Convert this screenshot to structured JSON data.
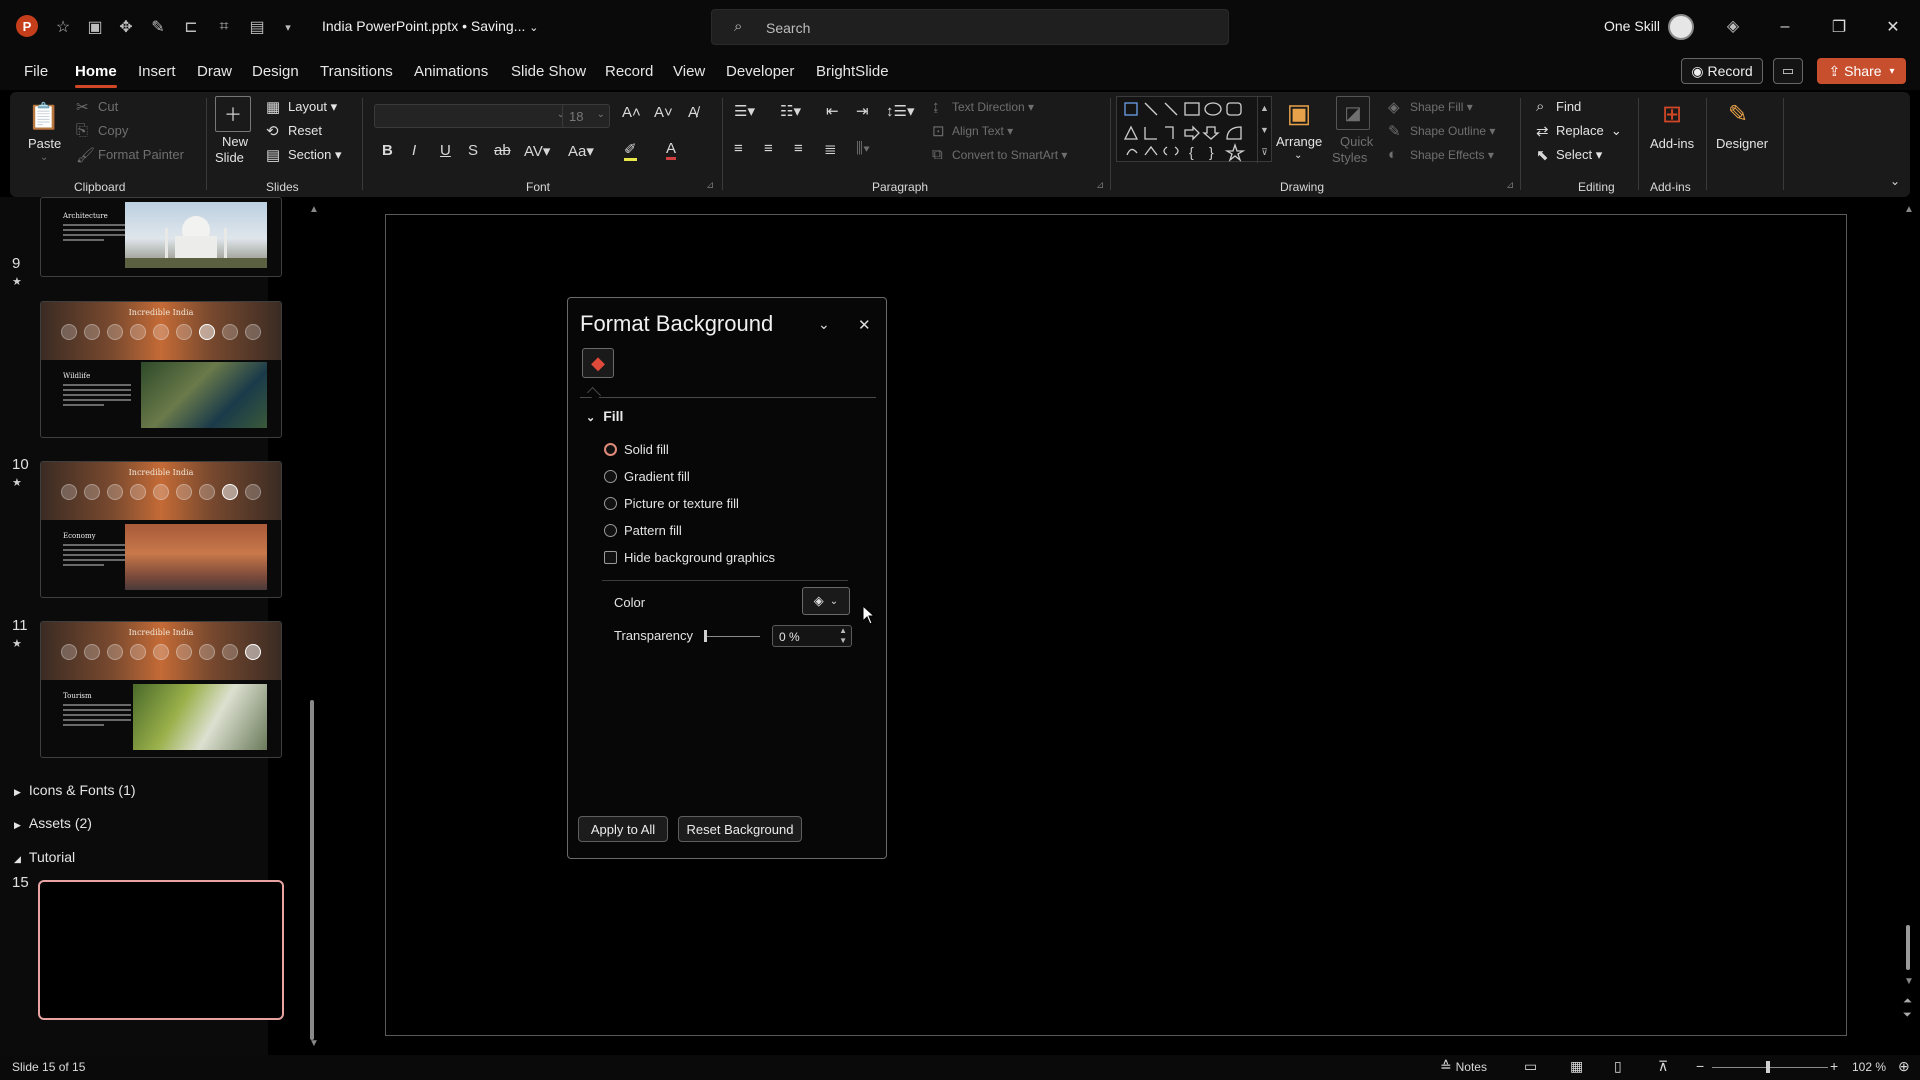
{
  "titlebar": {
    "doc_title": "India PowerPoint.pptx • Saving...",
    "search_placeholder": "Search",
    "user_name": "One Skill",
    "app_letter": "P"
  },
  "menu": {
    "tabs": [
      "File",
      "Home",
      "Insert",
      "Draw",
      "Design",
      "Transitions",
      "Animations",
      "Slide Show",
      "Record",
      "View",
      "Developer",
      "BrightSlide"
    ],
    "active": "Home",
    "record_label": "Record",
    "share_label": "Share"
  },
  "ribbon": {
    "clipboard": {
      "paste": "Paste",
      "cut": "Cut",
      "copy": "Copy",
      "format_painter": "Format Painter",
      "label": "Clipboard"
    },
    "slides": {
      "new_slide_1": "New",
      "new_slide_2": "Slide",
      "layout": "Layout",
      "reset": "Reset",
      "section": "Section",
      "label": "Slides"
    },
    "font": {
      "size": "18",
      "label": "Font",
      "case": "Aa"
    },
    "paragraph": {
      "text_direction": "Text Direction",
      "align_text": "Align Text",
      "convert_smartart": "Convert to SmartArt",
      "label": "Paragraph"
    },
    "drawing": {
      "arrange": "Arrange",
      "quick_1": "Quick",
      "quick_2": "Styles",
      "shape_fill": "Shape Fill",
      "shape_outline": "Shape Outline",
      "shape_effects": "Shape Effects",
      "label": "Drawing"
    },
    "editing": {
      "find": "Find",
      "replace": "Replace",
      "select": "Select",
      "label": "Editing"
    },
    "addins": {
      "addins": "Add-ins",
      "label": "Add-ins",
      "designer": "Designer"
    }
  },
  "thumbnails": {
    "slide8": {
      "heading": "Architecture"
    },
    "slide9": {
      "num": "9",
      "title": "Incredible India",
      "heading": "Wildlife"
    },
    "slide10": {
      "num": "10",
      "title": "Incredible India",
      "heading": "Economy"
    },
    "slide11": {
      "num": "11",
      "title": "Incredible India",
      "heading": "Tourism"
    },
    "sections": [
      "Icons & Fonts (1)",
      "Assets (2)",
      "Tutorial"
    ],
    "active_num": "15"
  },
  "format_pane": {
    "title": "Format Background",
    "section": "Fill",
    "options": [
      "Solid fill",
      "Gradient fill",
      "Picture or texture fill",
      "Pattern fill"
    ],
    "selected_option": "Solid fill",
    "hide_graphics": "Hide background graphics",
    "color_label": "Color",
    "transparency_label": "Transparency",
    "transparency_value": "0 %",
    "apply_all": "Apply to All",
    "reset_bg": "Reset Background"
  },
  "status": {
    "slide_info": "Slide 15 of 15",
    "notes": "Notes",
    "zoom": "102 %"
  }
}
